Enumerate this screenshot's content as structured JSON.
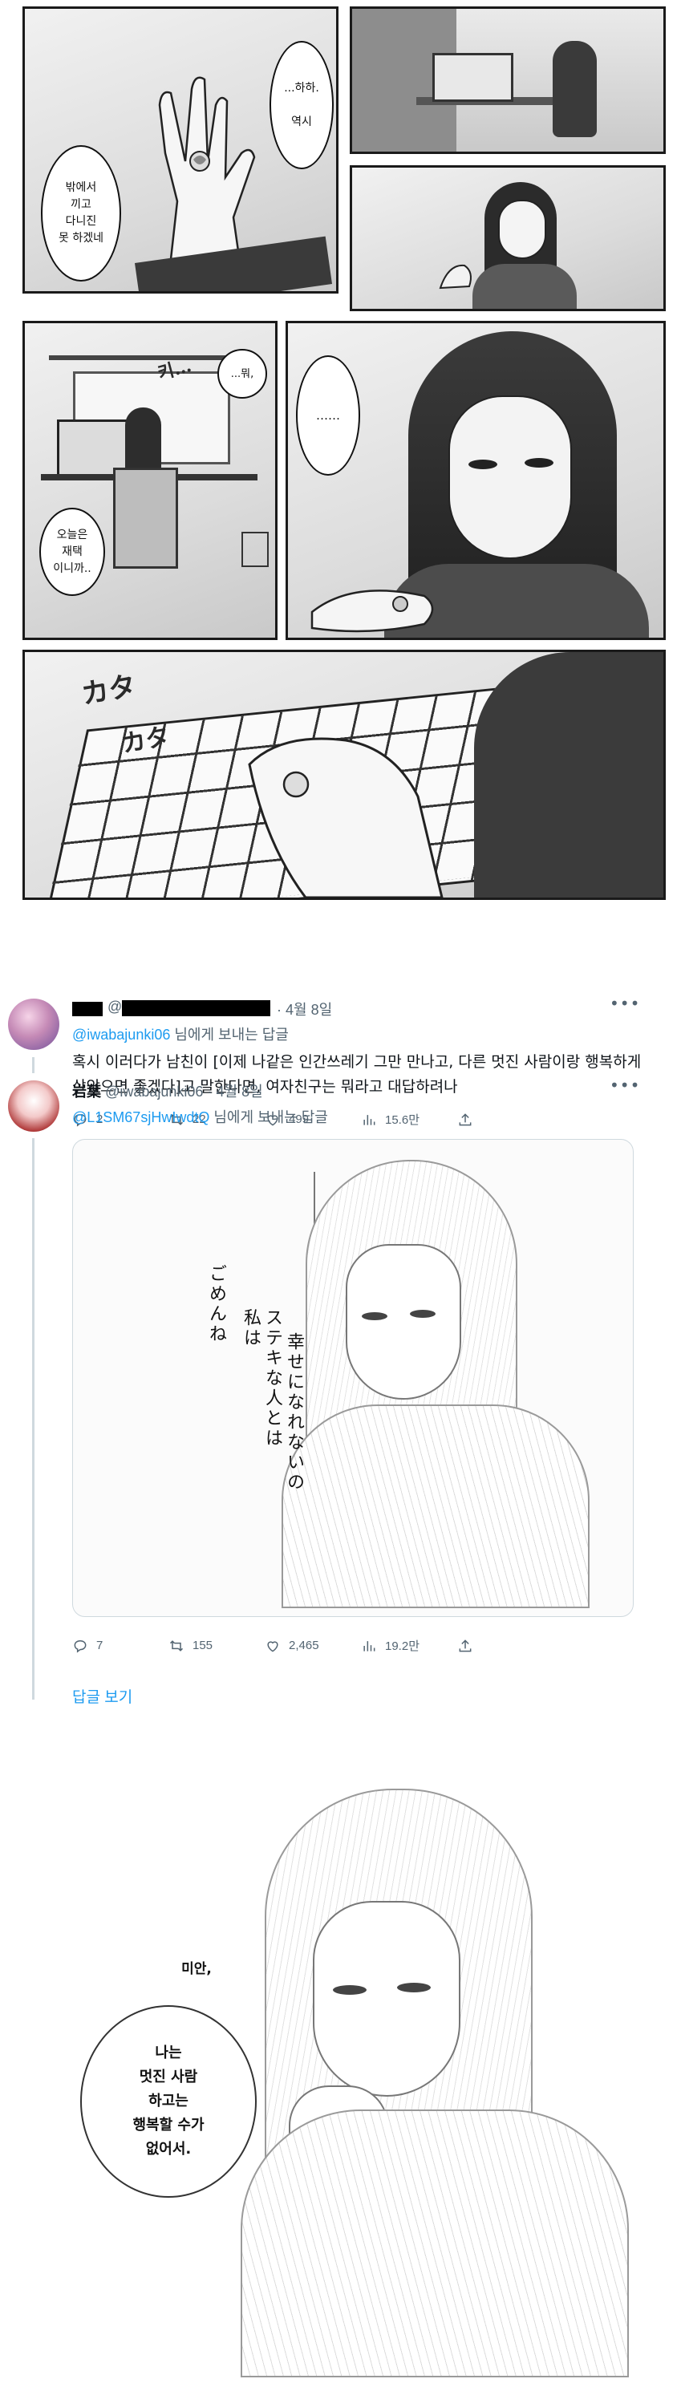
{
  "manga": {
    "panel1": {
      "bubble_left": "밖에서\n끼고\n다니진\n못 하겠네",
      "bubble_right": "...하하.\n\n역시"
    },
    "panel3": {
      "bubble_small": "...뭐,",
      "sfx": "키…",
      "bubble_bottom": "오늘은\n재택\n이니까..",
      "bubble_right": "……"
    },
    "panel5": {
      "sfx1": "カタ",
      "sfx2": "カタ"
    }
  },
  "tweet1": {
    "date": "4월 8일",
    "reply_handle": "@iwabajunki06",
    "reply_suffix": " 님에게 보내는 답글",
    "text": "혹시 이러다가 남친이 [이제 나같은 인간쓰레기 그만 만나고, 다른 멋진 사람이랑 행복하게 살았으면 좋겠다]고 말한다면, 여자친구는 뭐라고 대답하려나",
    "replies": "2",
    "retweets": "22",
    "likes": "499",
    "views": "15.6만"
  },
  "tweet2": {
    "name": "岩葉",
    "handle": "@iwabajunki06",
    "date": "4월 8일",
    "reply_handle": "@L1SM67sjHwIwdtQ",
    "reply_suffix": " 님에게 보내는 답글",
    "image_text_1": "ごめんね",
    "image_text_2": "私は",
    "image_text_3": "ステキな人とは",
    "image_text_4": "幸せになれないの",
    "replies": "7",
    "retweets": "155",
    "likes": "2,465",
    "views": "19.2만"
  },
  "show_replies": "답글 보기",
  "translation": {
    "bubble1": "미안,",
    "bubble2": "나는\n멋진 사람\n하고는\n행복할 수가\n없어서."
  },
  "colors": {
    "link": "#1d9bf0",
    "muted": "#536471",
    "divider": "#cfd9de"
  }
}
